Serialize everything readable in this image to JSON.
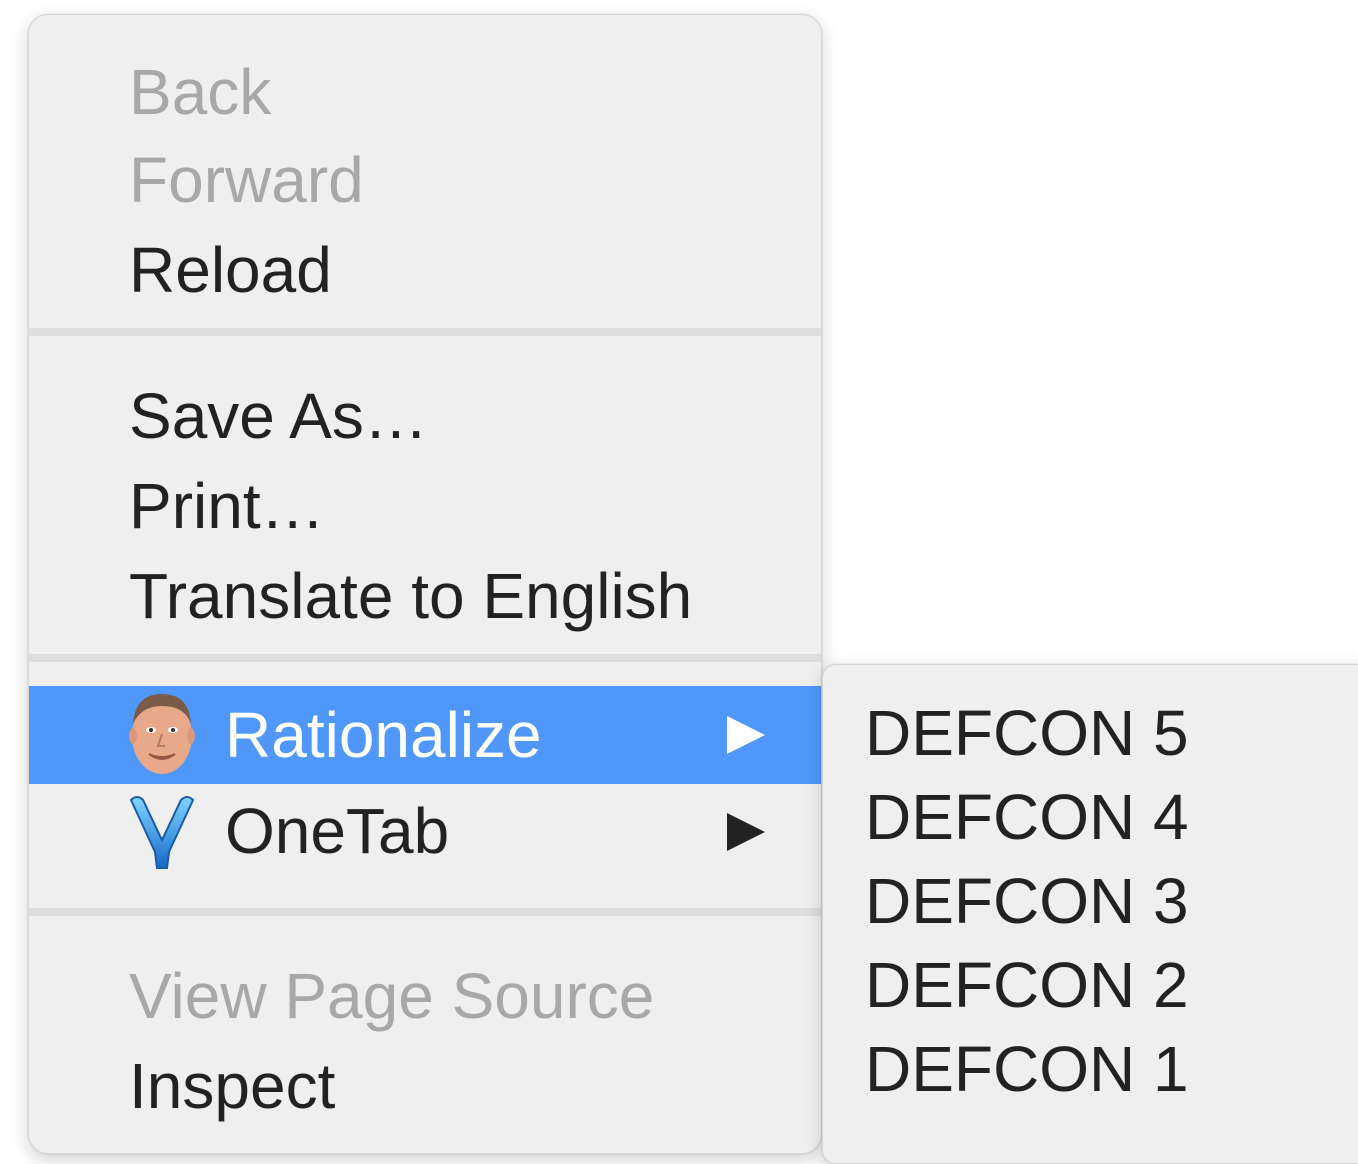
{
  "context_menu": {
    "items": [
      {
        "label": "Back",
        "enabled": false
      },
      {
        "label": "Forward",
        "enabled": false
      },
      {
        "label": "Reload",
        "enabled": true
      },
      {
        "label": "Save As…",
        "enabled": true
      },
      {
        "label": "Print…",
        "enabled": true
      },
      {
        "label": "Translate to English",
        "enabled": true
      },
      {
        "label": "Rationalize",
        "enabled": true,
        "icon": "face-avatar-icon",
        "has_submenu": true,
        "highlighted": true
      },
      {
        "label": "OneTab",
        "enabled": true,
        "icon": "onetab-funnel-icon",
        "has_submenu": true
      },
      {
        "label": "View Page Source",
        "enabled": false
      },
      {
        "label": "Inspect",
        "enabled": true
      }
    ]
  },
  "submenu": {
    "items": [
      {
        "label": "DEFCON 5"
      },
      {
        "label": "DEFCON 4"
      },
      {
        "label": "DEFCON 3"
      },
      {
        "label": "DEFCON 2"
      },
      {
        "label": "DEFCON 1"
      }
    ]
  },
  "colors": {
    "highlight": "#4f98f9",
    "menu_background": "#efefef",
    "text": "#222222",
    "disabled_text": "#a8a8a8",
    "separator": "#dedede"
  }
}
